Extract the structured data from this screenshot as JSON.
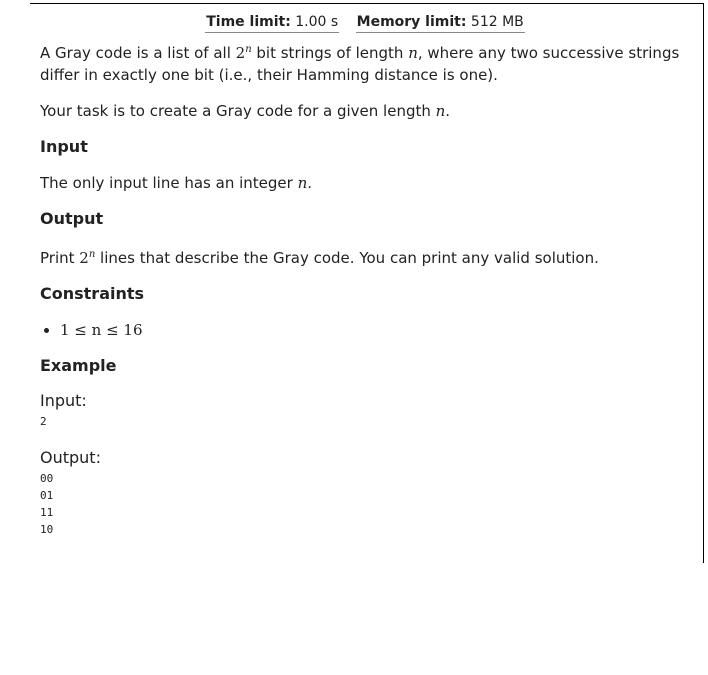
{
  "limits": {
    "time_label": "Time limit:",
    "time_value": "1.00 s",
    "memory_label": "Memory limit:",
    "memory_value": "512 MB"
  },
  "intro": {
    "p1_a": "A Gray code is a list of all ",
    "p1_base": "2",
    "p1_exp": "n",
    "p1_b": " bit strings of length ",
    "p1_var": "n",
    "p1_c": ", where any two successive strings differ in exactly one bit (i.e., their Hamming distance is one).",
    "p2_a": "Your task is to create a Gray code for a given length ",
    "p2_var": "n",
    "p2_b": "."
  },
  "input": {
    "heading": "Input",
    "text_a": "The only input line has an integer ",
    "text_var": "n",
    "text_b": "."
  },
  "output": {
    "heading": "Output",
    "text_a": "Print ",
    "base": "2",
    "exp": "n",
    "text_b": " lines that describe the Gray code. You can print any valid solution."
  },
  "constraints": {
    "heading": "Constraints",
    "items": [
      "1 ≤ n ≤ 16"
    ]
  },
  "example": {
    "heading": "Example",
    "input_label": "Input:",
    "input_value": "2",
    "output_label": "Output:",
    "output_value": "00\n01\n11\n10"
  }
}
